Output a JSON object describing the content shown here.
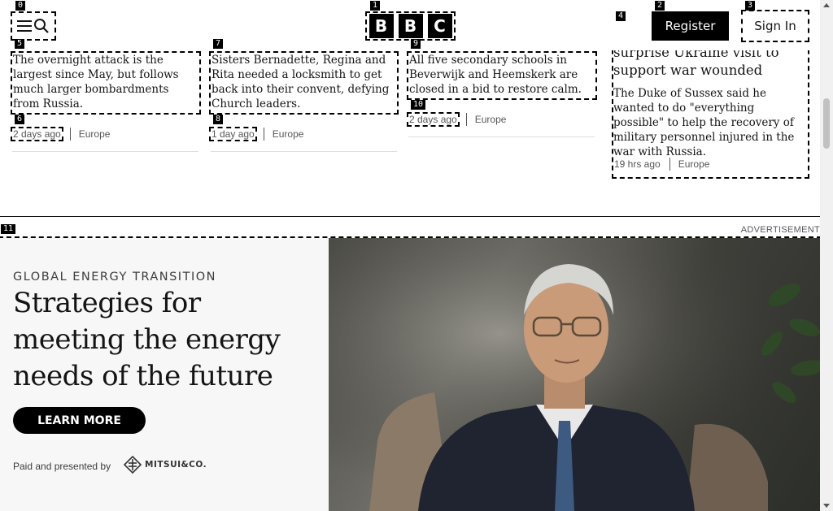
{
  "header": {
    "logo_letters": [
      "B",
      "B",
      "C"
    ],
    "register_label": "Register",
    "signin_label": "Sign In"
  },
  "articles": [
    {
      "summary": "The overnight attack is the largest since May, but follows much larger bombardments from Russia.",
      "time": "2 days ago",
      "section": "Europe"
    },
    {
      "summary": "Sisters Bernadette, Regina and Rita needed a locksmith to get back into their convent, defying Church leaders.",
      "time": "1 day ago",
      "section": "Europe"
    },
    {
      "summary": "All five secondary schools in Beverwijk and Heemskerk are closed in a bid to restore calm.",
      "time": "2 days ago",
      "section": "Europe"
    },
    {
      "headline": "surprise Ukraine visit to support war wounded",
      "summary": "The Duke of Sussex said he wanted to do \"everything possible\" to help the recovery of military personnel injured in the war with Russia.",
      "time": "19 hrs ago",
      "section": "Europe"
    }
  ],
  "ad": {
    "label": "ADVERTISEMENT",
    "kicker": "GLOBAL ENERGY TRANSITION",
    "title": "Strategies for meeting the energy needs of the future",
    "cta": "LEARN MORE",
    "sponsor_text": "Paid and presented by",
    "sponsor_logo": "MITSUI&CO."
  },
  "overlay_tags": [
    "0",
    "1",
    "2",
    "3",
    "4",
    "5",
    "6",
    "7",
    "8",
    "9",
    "10",
    "11"
  ],
  "colors": {
    "brand": "#000000",
    "text": "#141414",
    "meta": "#545658",
    "ad_bg": "#f7f7f7"
  },
  "icons": {
    "menu": "hamburger-icon",
    "search": "search-icon",
    "sponsor": "mitsui-logo-icon",
    "scroll_up": "arrow-up-icon",
    "scroll_down": "arrow-down-icon"
  }
}
